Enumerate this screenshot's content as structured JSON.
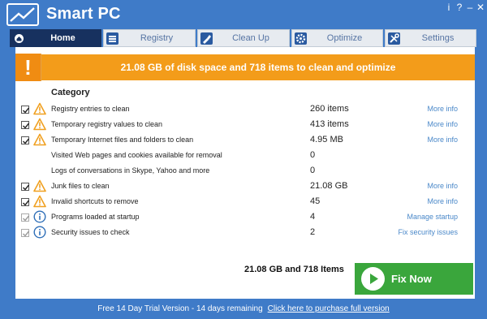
{
  "app": {
    "title": "Smart PC"
  },
  "window_controls": {
    "info": "i",
    "help": "?",
    "minimize": "–",
    "close": "✕"
  },
  "tabs": [
    {
      "label": "Home",
      "icon": "home-icon",
      "active": true
    },
    {
      "label": "Registry",
      "icon": "registry-icon",
      "active": false
    },
    {
      "label": "Clean Up",
      "icon": "cleanup-icon",
      "active": false
    },
    {
      "label": "Optimize",
      "icon": "gear-icon",
      "active": false
    },
    {
      "label": "Settings",
      "icon": "settings-icon",
      "active": false
    }
  ],
  "banner": {
    "icon": "!",
    "text": "21.08 GB of disk space and 718 items to clean and optimize"
  },
  "category_header": "Category",
  "rows": [
    {
      "label": "Registry entries to clean",
      "value": "260 items",
      "link": "More info",
      "checked": true,
      "status": "warning"
    },
    {
      "label": "Temporary registry values to clean",
      "value": "413 items",
      "link": "More info",
      "checked": true,
      "status": "warning"
    },
    {
      "label": "Temporary Internet files and folders to clean",
      "value": "4.95 MB",
      "link": "More info",
      "checked": true,
      "status": "warning"
    },
    {
      "label": "Visited Web pages and cookies available for removal",
      "value": "0",
      "link": "",
      "checked": false,
      "status": "none"
    },
    {
      "label": "Logs of conversations in Skype, Yahoo and more",
      "value": "0",
      "link": "",
      "checked": false,
      "status": "none"
    },
    {
      "label": "Junk files to clean",
      "value": "21.08 GB",
      "link": "More info",
      "checked": true,
      "status": "warning"
    },
    {
      "label": "Invalid shortcuts to remove",
      "value": "45",
      "link": "More info",
      "checked": true,
      "status": "warning"
    },
    {
      "label": "Programs loaded at startup",
      "value": "4",
      "link": "Manage startup",
      "checked": true,
      "status": "info"
    },
    {
      "label": "Security issues to check",
      "value": "2",
      "link": "Fix security issues",
      "checked": true,
      "status": "info"
    }
  ],
  "summary": "21.08 GB and 718 Items",
  "fix_button": {
    "label": "Fix Now"
  },
  "footer": {
    "trial_text": "Free 14 Day Trial Version - 14 days remaining",
    "purchase_link": "Click here to purchase full version"
  },
  "colors": {
    "background": "#3f7bc8",
    "banner": "#f39c1a",
    "active_tab": "#17315f",
    "fix_button": "#3aa63c",
    "link": "#4a88c9"
  }
}
